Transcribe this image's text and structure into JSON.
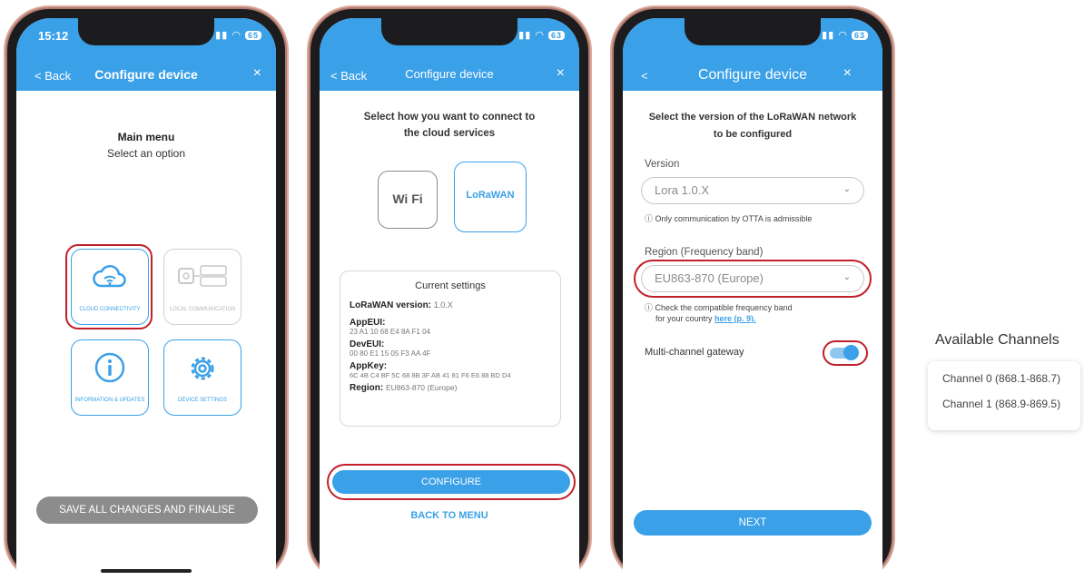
{
  "screen1": {
    "time": "15:12",
    "battery": "65",
    "back": "< Back",
    "title": "Configure device",
    "close": "×",
    "main_menu": "Main menu",
    "select_option": "Select an option",
    "tiles": {
      "cloud": "CLOUD CONNECTIVITY",
      "local": "LOCAL COMMUNICATION",
      "info": "INFORMATION & UPDATES",
      "settings": "DEVICE SETTINGS"
    },
    "save_button": "SAVE ALL CHANGES AND FINALISE"
  },
  "screen2": {
    "battery": "63",
    "back": "< Back",
    "title": "Configure device",
    "close": "×",
    "heading": "Select how you want to connect to the cloud services",
    "wifi_logo": "Wi Fi",
    "lora_logo": "LoRaWAN",
    "settings_title": "Current settings",
    "lorawan_version_label": "LoRaWAN version:",
    "lorawan_version_value": "1.0.X",
    "appeui_label": "AppEUI:",
    "appeui_value": "23 A1 10 68 E4 8A F1 04",
    "deveui_label": "DevEUI:",
    "deveui_value": "00 80 E1 15 05 F3 AA 4F",
    "appkey_label": "AppKey:",
    "appkey_value": "6C 4B C4 BF 5C 68 8B 3F AB 41 81 F6 E6 88 BD D4",
    "region_label": "Region:",
    "region_value": "EU863-870 (Europe)",
    "configure_button": "CONFIGURE",
    "back_to_menu": "BACK TO MENU"
  },
  "screen3": {
    "battery": "63",
    "back": "<",
    "title": "Configure device",
    "close": "×",
    "heading": "Select the version of the LoRaWAN network to be configured",
    "version_label": "Version",
    "version_value": "Lora 1.0.X",
    "version_note": "Only communication by OTTA is admissible",
    "region_label": "Region (Frequency band)",
    "region_value": "EU863-870 (Europe)",
    "region_note": "Check the compatible frequency band",
    "region_note2": "for your country",
    "region_link": "here (p. 9).",
    "multichannel_label": "Multi-channel gateway",
    "multichannel_on": true,
    "next_button": "NEXT"
  },
  "channels": {
    "title": "Available Channels",
    "items": [
      "Channel 0 (868.1-868.7)",
      "Channel 1 (868.9-869.5)"
    ]
  },
  "colors": {
    "accent": "#3aa0e8",
    "highlight": "#c0202a"
  }
}
